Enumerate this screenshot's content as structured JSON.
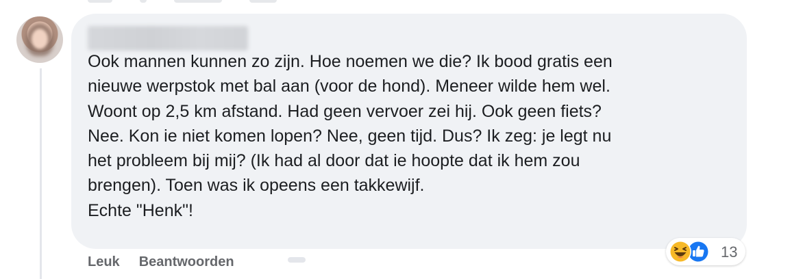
{
  "comment": {
    "text_lines": [
      "Ook mannen kunnen zo zijn. Hoe noemen we die? Ik bood gratis een",
      "nieuwe werpstok met bal aan (voor de hond). Meneer wilde hem wel.",
      "Woont op 2,5 km afstand. Had geen vervoer zei hij. Ook geen fiets?",
      "Nee. Kon ie niet komen lopen? Nee, geen tijd. Dus? Ik zeg: je legt nu",
      "het probleem bij mij? (Ik had al door dat ie hoopte dat ik hem zou",
      "brengen). Toen was ik opeens een takkewijf.",
      "Echte \"Henk\"!"
    ],
    "reaction_count": "13"
  },
  "actions": {
    "like_label": "Leuk",
    "reply_label": "Beantwoorden"
  },
  "colors": {
    "bubble": "#f0f2f5",
    "text": "#1c1e21",
    "secondary": "#65676b",
    "like_blue": "#1877f2",
    "haha_yellow": "#f7b928"
  }
}
